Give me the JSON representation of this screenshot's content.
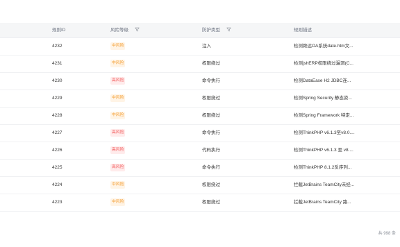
{
  "table": {
    "headers": {
      "id": "规则ID",
      "risk": "风险等级",
      "type": "防护类型",
      "desc": "规则描述"
    },
    "rows": [
      {
        "id": "4232",
        "risk": "中风险",
        "level": "mid",
        "type": "注入",
        "desc": "检测致远OA系统date.htm文..."
      },
      {
        "id": "4231",
        "risk": "中风险",
        "level": "mid",
        "type": "权限绕过",
        "desc": "检测jshERP权限绕过漏洞(C..."
      },
      {
        "id": "4230",
        "risk": "高风险",
        "level": "high",
        "type": "命令执行",
        "desc": "检测DataEase H2 JDBC连..."
      },
      {
        "id": "4229",
        "risk": "中风险",
        "level": "mid",
        "type": "权限绕过",
        "desc": "检测Spring Security 静态资..."
      },
      {
        "id": "4228",
        "risk": "中风险",
        "level": "mid",
        "type": "权限绕过",
        "desc": "检测Spring Framework 特定..."
      },
      {
        "id": "4227",
        "risk": "高风险",
        "level": "high",
        "type": "命令执行",
        "desc": "检测ThinkPHP v6.1.3至v8.0...."
      },
      {
        "id": "4226",
        "risk": "高风险",
        "level": "high",
        "type": "代码执行",
        "desc": "检测ThinkPHP v6.1.3 至 v8...."
      },
      {
        "id": "4225",
        "risk": "高风险",
        "level": "high",
        "type": "命令执行",
        "desc": "检测ThinkPHP 8.1.2反序列..."
      },
      {
        "id": "4224",
        "risk": "中风险",
        "level": "mid",
        "type": "权限绕过",
        "desc": "拦截JetBrains TeamCity未经..."
      },
      {
        "id": "4223",
        "risk": "中风险",
        "level": "mid",
        "type": "权限绕过",
        "desc": "拦截JetBrains TeamCity 路..."
      }
    ]
  },
  "footer": {
    "total": "共 998 条"
  },
  "colors": {
    "mid": "#f59b2c",
    "high": "#f25a5a"
  },
  "icons": {
    "filter": "filter-icon"
  }
}
